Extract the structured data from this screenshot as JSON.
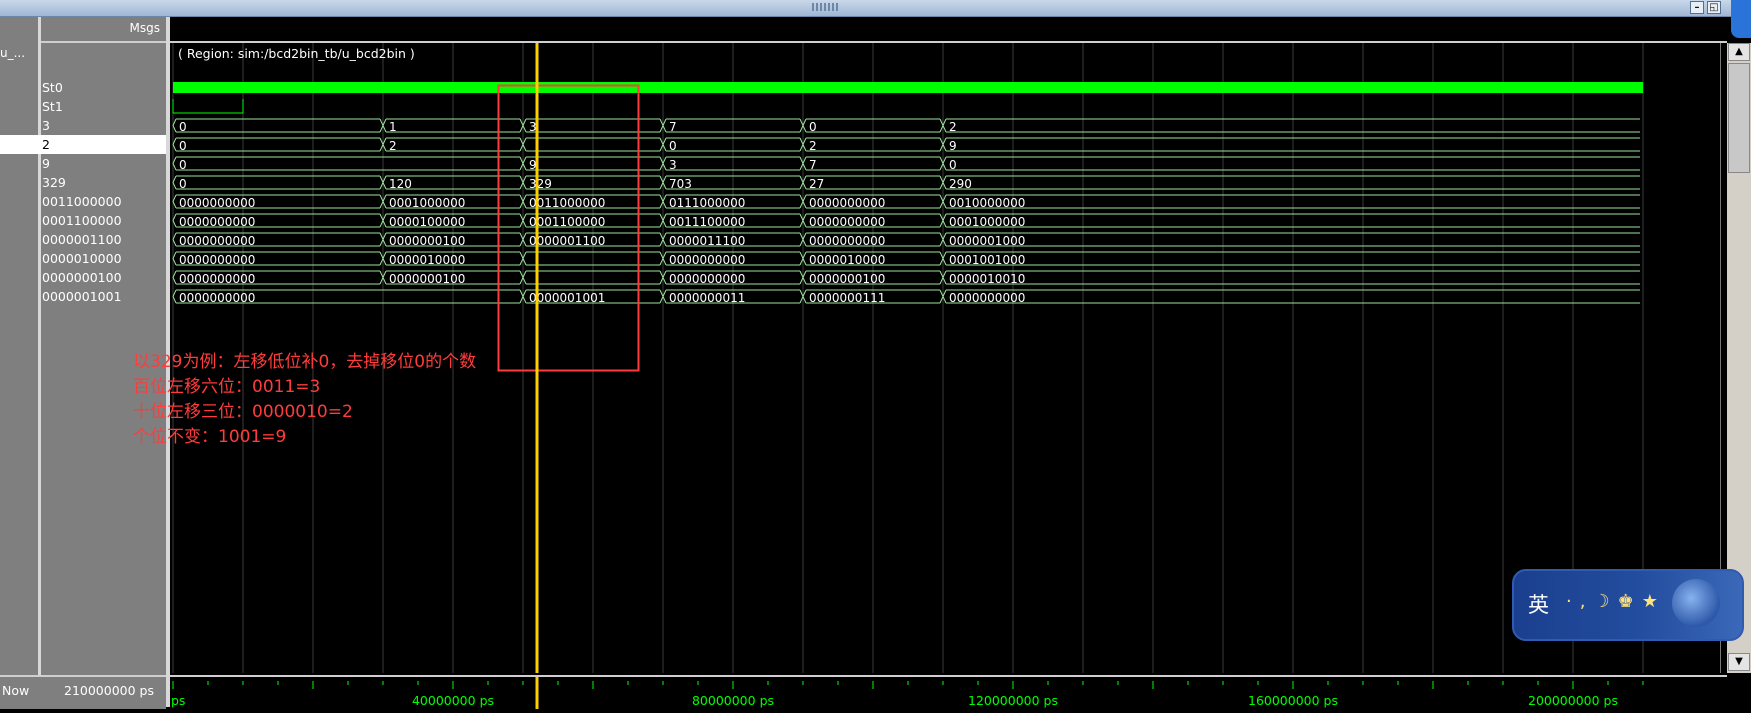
{
  "window": {
    "minimize_glyph": "–",
    "restore_glyph": "◱"
  },
  "header": {
    "msgs_label": "Msgs"
  },
  "name_column": {
    "top_label": "u_..."
  },
  "region_label": "( Region: sim:/bcd2bin_tb/u_bcd2bin )",
  "signals": [
    {
      "msg": "St0",
      "type": "bit_high"
    },
    {
      "msg": "St1",
      "type": "bit_clk"
    },
    {
      "msg": "3",
      "type": "bus",
      "segments": [
        {
          "t": 0,
          "v": "0"
        },
        {
          "t": 30000000,
          "v": "1"
        },
        {
          "t": 50000000,
          "v": "3"
        },
        {
          "t": 70000000,
          "v": "7"
        },
        {
          "t": 90000000,
          "v": "0"
        },
        {
          "t": 110000000,
          "v": "2"
        }
      ]
    },
    {
      "msg": "2",
      "type": "bus",
      "selected": true,
      "segments": [
        {
          "t": 0,
          "v": "0"
        },
        {
          "t": 30000000,
          "v": "2"
        },
        {
          "t": 50000000,
          "v": ""
        },
        {
          "t": 70000000,
          "v": "0"
        },
        {
          "t": 90000000,
          "v": "2"
        },
        {
          "t": 110000000,
          "v": "9"
        }
      ]
    },
    {
      "msg": "9",
      "type": "bus",
      "segments": [
        {
          "t": 0,
          "v": "0"
        },
        {
          "t": 50000000,
          "v": "9"
        },
        {
          "t": 70000000,
          "v": "3"
        },
        {
          "t": 90000000,
          "v": "7"
        },
        {
          "t": 110000000,
          "v": "0"
        }
      ]
    },
    {
      "msg": "329",
      "type": "bus",
      "segments": [
        {
          "t": 0,
          "v": "0"
        },
        {
          "t": 30000000,
          "v": "120"
        },
        {
          "t": 50000000,
          "v": "329"
        },
        {
          "t": 70000000,
          "v": "703"
        },
        {
          "t": 90000000,
          "v": "27"
        },
        {
          "t": 110000000,
          "v": "290"
        }
      ]
    },
    {
      "msg": "0011000000",
      "type": "bus",
      "segments": [
        {
          "t": 0,
          "v": "0000000000"
        },
        {
          "t": 30000000,
          "v": "0001000000"
        },
        {
          "t": 50000000,
          "v": "0011000000"
        },
        {
          "t": 70000000,
          "v": "0111000000"
        },
        {
          "t": 90000000,
          "v": "0000000000"
        },
        {
          "t": 110000000,
          "v": "0010000000"
        }
      ]
    },
    {
      "msg": "0001100000",
      "type": "bus",
      "segments": [
        {
          "t": 0,
          "v": "0000000000"
        },
        {
          "t": 30000000,
          "v": "0000100000"
        },
        {
          "t": 50000000,
          "v": "0001100000"
        },
        {
          "t": 70000000,
          "v": "0011100000"
        },
        {
          "t": 90000000,
          "v": "0000000000"
        },
        {
          "t": 110000000,
          "v": "0001000000"
        }
      ]
    },
    {
      "msg": "0000001100",
      "type": "bus",
      "segments": [
        {
          "t": 0,
          "v": "0000000000"
        },
        {
          "t": 30000000,
          "v": "0000000100"
        },
        {
          "t": 50000000,
          "v": "0000001100"
        },
        {
          "t": 70000000,
          "v": "0000011100"
        },
        {
          "t": 90000000,
          "v": "0000000000"
        },
        {
          "t": 110000000,
          "v": "0000001000"
        }
      ]
    },
    {
      "msg": "0000010000",
      "type": "bus",
      "segments": [
        {
          "t": 0,
          "v": "0000000000"
        },
        {
          "t": 30000000,
          "v": "0000010000"
        },
        {
          "t": 50000000,
          "v": ""
        },
        {
          "t": 70000000,
          "v": "0000000000"
        },
        {
          "t": 90000000,
          "v": "0000010000"
        },
        {
          "t": 110000000,
          "v": "0001001000"
        }
      ]
    },
    {
      "msg": "0000000100",
      "type": "bus",
      "segments": [
        {
          "t": 0,
          "v": "0000000000"
        },
        {
          "t": 30000000,
          "v": "0000000100"
        },
        {
          "t": 50000000,
          "v": ""
        },
        {
          "t": 70000000,
          "v": "0000000000"
        },
        {
          "t": 90000000,
          "v": "0000000100"
        },
        {
          "t": 110000000,
          "v": "0000010010"
        }
      ]
    },
    {
      "msg": "0000001001",
      "type": "bus",
      "segments": [
        {
          "t": 0,
          "v": "0000000000"
        },
        {
          "t": 50000000,
          "v": "0000001001"
        },
        {
          "t": 70000000,
          "v": "0000000011"
        },
        {
          "t": 90000000,
          "v": "0000000111"
        },
        {
          "t": 110000000,
          "v": "0000000000"
        }
      ]
    }
  ],
  "timeline": {
    "start": 0,
    "end": 210000000,
    "cursor": 52000000,
    "sim_end": 210000000,
    "labels": [
      {
        "t": 0,
        "text": "ps"
      },
      {
        "t": 40000000,
        "text": "40000000 ps"
      },
      {
        "t": 80000000,
        "text": "80000000 ps"
      },
      {
        "t": 120000000,
        "text": "120000000 ps"
      },
      {
        "t": 160000000,
        "text": "160000000 ps"
      },
      {
        "t": 200000000,
        "text": "200000000 ps"
      }
    ]
  },
  "now": {
    "label": "Now",
    "value": "210000000 ps"
  },
  "annotation": {
    "box_t_start": 46500000,
    "box_t_end": 66500000,
    "lines": [
      "以329为例：左移低位补0，去掉移位0的个数",
      "百位左移六位：0011=3",
      "十位左移三位：0000010=2",
      "个位不变：1001=9"
    ]
  },
  "ime": {
    "lang": "英",
    "icons": "·,☽♚★"
  },
  "colors": {
    "wave": "#9ce49c",
    "bit_high": "#00ff00",
    "cursor": "#ffd000",
    "grid": "#3c3c3c",
    "annotation": "#ff3c3c"
  }
}
